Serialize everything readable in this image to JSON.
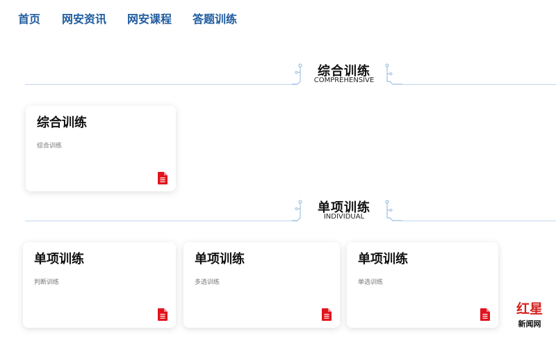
{
  "nav": {
    "items": [
      "首页",
      "网安资讯",
      "网安课程",
      "答题训练"
    ]
  },
  "sections": [
    {
      "title": "综合训练",
      "subtitle": "COMPREHENSIVE",
      "cards": [
        {
          "title": "综合训练",
          "desc": "综合训练"
        }
      ]
    },
    {
      "title": "单项训练",
      "subtitle": "INDIVIDUAL",
      "cards": [
        {
          "title": "单项训练",
          "desc": "判断训练"
        },
        {
          "title": "单项训练",
          "desc": "多选训练"
        },
        {
          "title": "单项训练",
          "desc": "单选训练"
        }
      ]
    }
  ],
  "watermark": {
    "top": "红星",
    "bottom": "新闻网"
  },
  "colors": {
    "nav": "#1f5b9f",
    "line": "#bfd5ea",
    "icon": "#e0141e",
    "brand": "#d4201e"
  },
  "icons": {
    "card_icon": "document-icon"
  }
}
